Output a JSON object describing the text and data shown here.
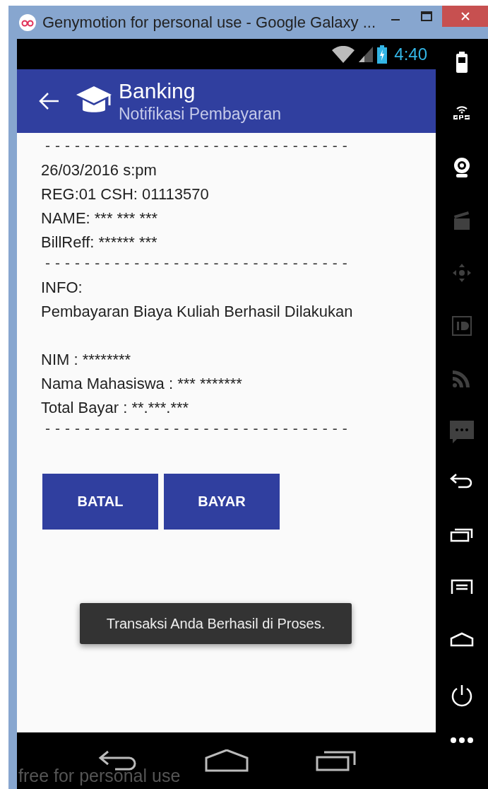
{
  "window": {
    "title": "Genymotion for personal use - Google Galaxy ..."
  },
  "status_bar": {
    "time": "4:40"
  },
  "app_bar": {
    "title": "Banking",
    "subtitle": "Notifikasi Pembayaran"
  },
  "receipt": [
    {
      "kind": "separator",
      "text": "- - - - - - - - - - - - - - - - - - - - - - - - - - - - - - -"
    },
    {
      "kind": "lines",
      "lines": [
        "26/03/2016 s:pm",
        "REG:01 CSH: 01113570",
        "NAME: *** *** ***",
        "BillReff: ****** ***"
      ]
    },
    {
      "kind": "separator",
      "text": "- - - - - - - - - - - - - - - - - - - - - - - - - - - - - - -"
    },
    {
      "kind": "lines",
      "lines": [
        "INFO:",
        "Pembayaran Biaya Kuliah Berhasil Dilakukan"
      ]
    },
    {
      "kind": "lines",
      "lines": [
        "NIM : ********",
        "Nama Mahasiswa : *** *******",
        "Total Bayar : **.***.***"
      ]
    },
    {
      "kind": "separator",
      "text": "- - - - - - - - - - - - - - - - - - - - - - - - - - - - - - -"
    }
  ],
  "buttons": [
    "BATAL",
    "BAYAR"
  ],
  "toast": "Transaksi Anda Berhasil di Proses.",
  "overlay_text": "free for personal use",
  "side_panel": [
    {
      "kind": "battery",
      "disabled": false
    },
    {
      "kind": "gps",
      "disabled": false
    },
    {
      "kind": "webcam",
      "disabled": false
    },
    {
      "kind": "clapper",
      "disabled": true
    },
    {
      "kind": "dpad",
      "disabled": true
    },
    {
      "kind": "id",
      "disabled": true
    },
    {
      "kind": "rss",
      "disabled": true
    },
    {
      "kind": "message",
      "disabled": true
    },
    {
      "kind": "back",
      "disabled": false
    },
    {
      "kind": "recent",
      "disabled": false
    },
    {
      "kind": "menu",
      "disabled": false
    },
    {
      "kind": "home",
      "disabled": false
    },
    {
      "kind": "power",
      "disabled": false
    },
    {
      "kind": "more",
      "disabled": false
    }
  ]
}
